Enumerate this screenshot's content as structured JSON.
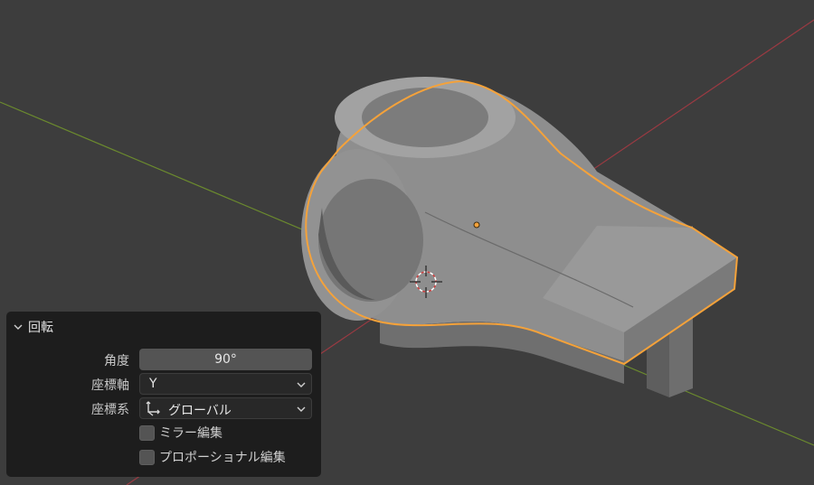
{
  "colors": {
    "viewport_bg": "#3d3d3d",
    "x_axis": "#9a3a42",
    "y_axis": "#6b8a2e",
    "selection": "#f5a23a",
    "panel_bg": "#1d1d1d",
    "model_fill": "#8e8e8e"
  },
  "operator_panel": {
    "title": "回転",
    "collapse_icon": "chevron-down-icon",
    "angle": {
      "label": "角度",
      "value": "90°"
    },
    "axis": {
      "label": "座標軸",
      "value": "Y"
    },
    "orientation": {
      "label": "座標系",
      "value": "グローバル",
      "icon": "global-axes-icon"
    },
    "mirror_edit": {
      "label": "ミラー編集",
      "checked": false
    },
    "proportional_edit": {
      "label": "プロポーショナル編集",
      "checked": false
    }
  }
}
